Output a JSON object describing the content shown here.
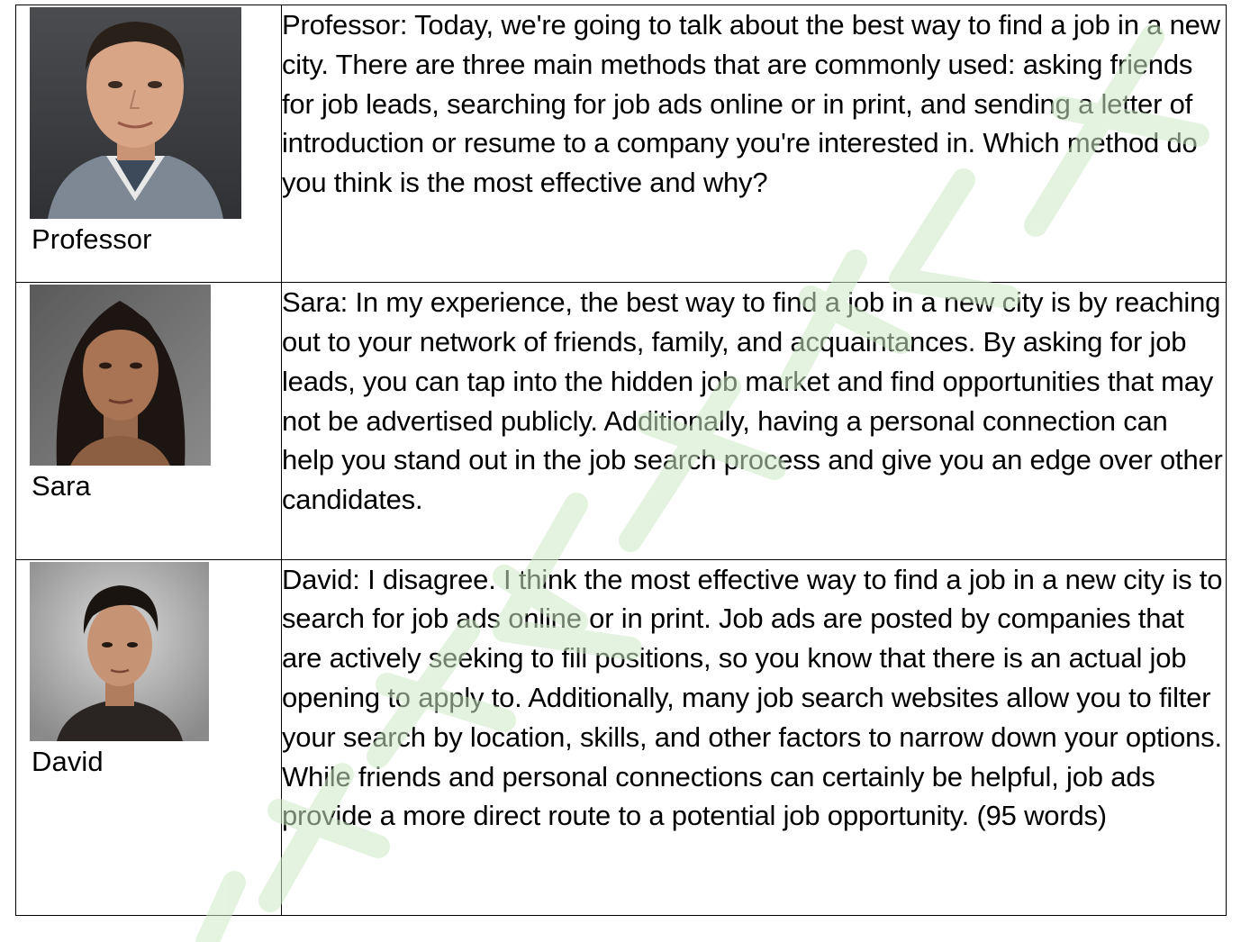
{
  "rows": [
    {
      "speaker": "Professor",
      "photo_icon": "professor-portrait",
      "text": "Professor: Today, we're going to talk about the best way to find a job in a new city. There are three main methods that are commonly used: asking friends for job leads, searching for job ads online or in print, and sending a letter of introduction or resume to a company you're interested in. Which method do you think is the most effective and why?"
    },
    {
      "speaker": "Sara",
      "photo_icon": "sara-portrait",
      "text": "Sara: In my experience, the best way to find a job in a new city is by reaching out to your network of friends, family, and acquaintances. By asking for job leads, you can tap into the hidden job market and find opportunities that may not be advertised publicly. Additionally, having a personal connection can help you stand out in the job search process and give you an edge over other candidates."
    },
    {
      "speaker": "David",
      "photo_icon": "david-portrait",
      "text": "David: I disagree. I think the most effective way to find a job in a new city is to search for job ads online or in print. Job ads are posted by companies that are actively seeking to fill positions, so you know that there is an actual job opening to apply to. Additionally, many job search websites allow you to filter your search by location, skills, and other factors to narrow down your options. While friends and personal connections can certainly be helpful, job ads provide a more direct route to a potential job opportunity. (95 words)"
    }
  ],
  "watermark": {
    "color": "#cfe9c8",
    "text": "州新东方国际教育"
  }
}
